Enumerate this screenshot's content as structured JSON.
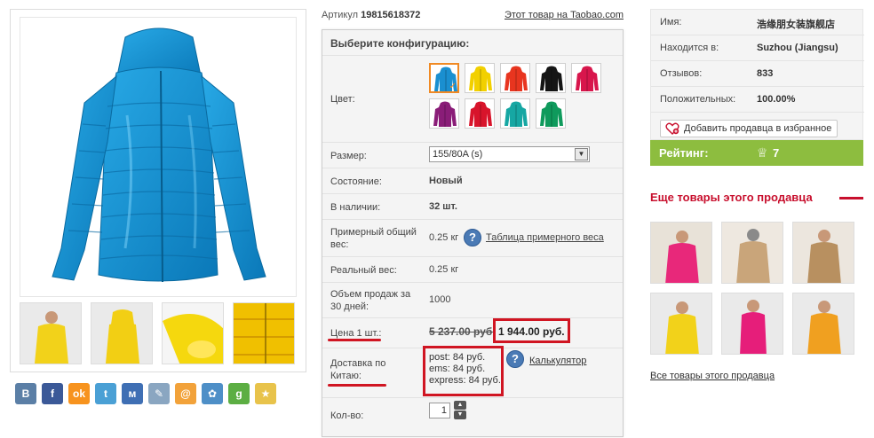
{
  "product": {
    "article_label": "Артикул",
    "article_number": "19815618372",
    "taobao_link": "Этот товар на Taobao.com",
    "main_color": "#1293d2",
    "thumbnails": [
      {
        "name": "thumb-yellow-front",
        "color": "#f2d21a"
      },
      {
        "name": "thumb-yellow-back",
        "color": "#f2cf14"
      },
      {
        "name": "thumb-yellow-cuff",
        "color": "#f5d80e"
      },
      {
        "name": "thumb-yellow-zipper",
        "color": "#f0c000"
      }
    ]
  },
  "social": [
    {
      "name": "vk-icon",
      "glyph": "В",
      "color": "#5b7fa6"
    },
    {
      "name": "facebook-icon",
      "glyph": "f",
      "color": "#3b5998"
    },
    {
      "name": "odnoklassniki-icon",
      "glyph": "ok",
      "color": "#f7931e"
    },
    {
      "name": "twitter-icon",
      "glyph": "t",
      "color": "#4aa0d5"
    },
    {
      "name": "moimir-icon",
      "glyph": "м",
      "color": "#3f6fb4"
    },
    {
      "name": "livejournal-icon",
      "glyph": "✎",
      "color": "#8aa6c1"
    },
    {
      "name": "mail-icon",
      "glyph": "@",
      "color": "#f2a23a"
    },
    {
      "name": "settings-icon",
      "glyph": "✿",
      "color": "#4e8fc7"
    },
    {
      "name": "googleplus-icon",
      "glyph": "g",
      "color": "#5cae43"
    },
    {
      "name": "favorite-star-icon",
      "glyph": "★",
      "color": "#e8c34b"
    }
  ],
  "config": {
    "title": "Выберите конфигурацию:",
    "color_label": "Цвет:",
    "colors": [
      "#1a8fd0",
      "#f2d000",
      "#e8351f",
      "#151515",
      "#d8164c",
      "#8a1d78",
      "#d8142b",
      "#16a7a3",
      "#0f9a5c"
    ],
    "selected_color_index": 0,
    "size_label": "Размер:",
    "size_value": "155/80A (s)",
    "condition_label": "Состояние:",
    "condition_value": "Новый",
    "stock_label": "В наличии:",
    "stock_value": "32 шт.",
    "approx_weight_label": "Примерный общий вес:",
    "approx_weight_value": "0.25 кг",
    "weight_table_link": "Таблица примерного веса",
    "real_weight_label": "Реальный вес:",
    "real_weight_value": "0.25 кг",
    "sales_label": "Объем продаж за 30 дней:",
    "sales_value": "1000",
    "price_label": "Цена 1 шт.:",
    "price_old": "5 237.00 руб.",
    "price_new": "1 944.00 руб.",
    "shipping_label": "Доставка по Китаю:",
    "shipping_lines": [
      "post: 84 руб.",
      "ems: 84 руб.",
      "express: 84 руб."
    ],
    "calculator_link": "Калькулятор",
    "qty_label": "Кол-во:",
    "qty_value": "1"
  },
  "seller": {
    "name_label": "Имя:",
    "name_value": "浩缘朋女装旗舰店",
    "location_label": "Находится в:",
    "location_value": "Suzhou (Jiangsu)",
    "reviews_label": "Отзывов:",
    "reviews_value": "833",
    "positive_label": "Положительных:",
    "positive_value": "100.00%",
    "favorite_button": "Добавить продавца в избранное",
    "rating_label": "Рейтинг:",
    "rating_value": "7"
  },
  "more": {
    "title": "Еще товары этого продавца",
    "items": [
      {
        "name": "more-item-pink",
        "color": "#e8287a"
      },
      {
        "name": "more-item-beige",
        "color": "#c9a57a"
      },
      {
        "name": "more-item-tan",
        "color": "#b89060"
      },
      {
        "name": "more-item-yellow",
        "color": "#f2d21a"
      },
      {
        "name": "more-item-pink-vest",
        "color": "#e61e7a"
      },
      {
        "name": "more-item-orange",
        "color": "#f0a020"
      }
    ],
    "all_link": "Все товары этого продавца"
  }
}
